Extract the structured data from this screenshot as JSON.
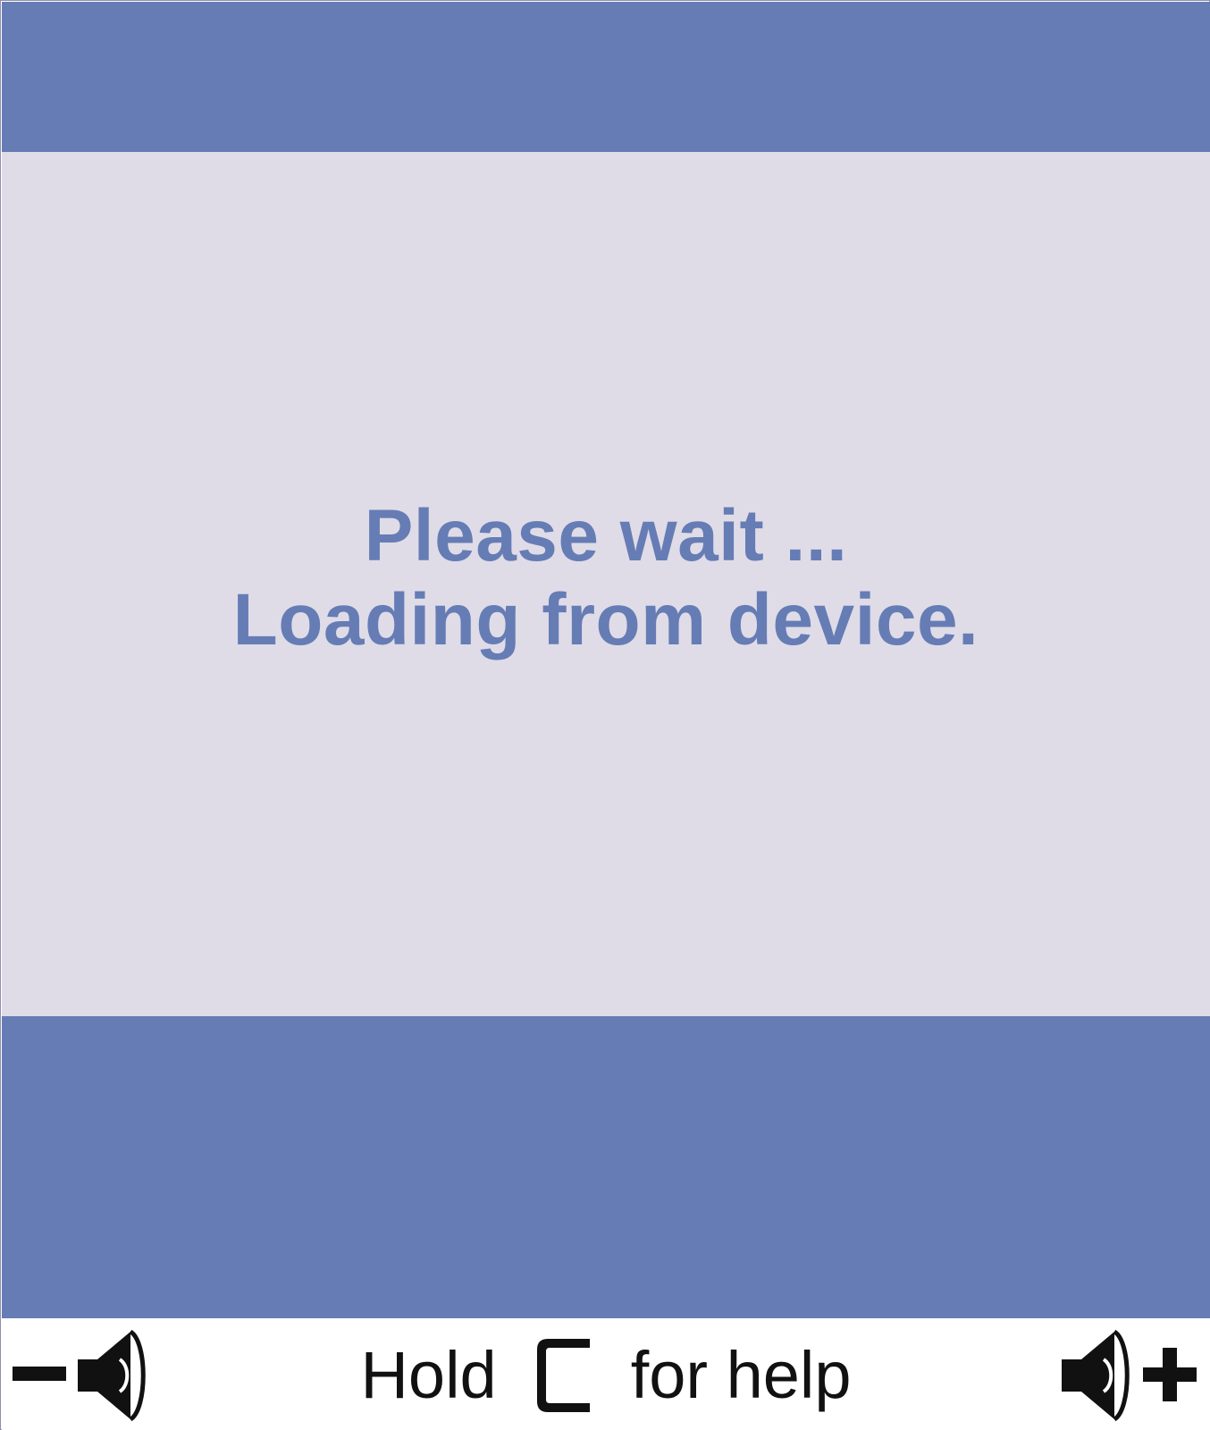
{
  "screen": {
    "message_line1": "Please wait ...",
    "message_line2": "Loading from device."
  },
  "footer": {
    "hold_label": "Hold",
    "key_label": "C",
    "for_help_label": "for help",
    "volume_down_icon": "volume-down-icon",
    "volume_up_icon": "volume-up-icon",
    "c_key_icon": "c-key-icon"
  },
  "colors": {
    "band": "#667cb4",
    "content_background": "#dfdce8",
    "message_text": "#667cb4",
    "footer_background": "#ffffff",
    "footer_text": "#111111"
  }
}
